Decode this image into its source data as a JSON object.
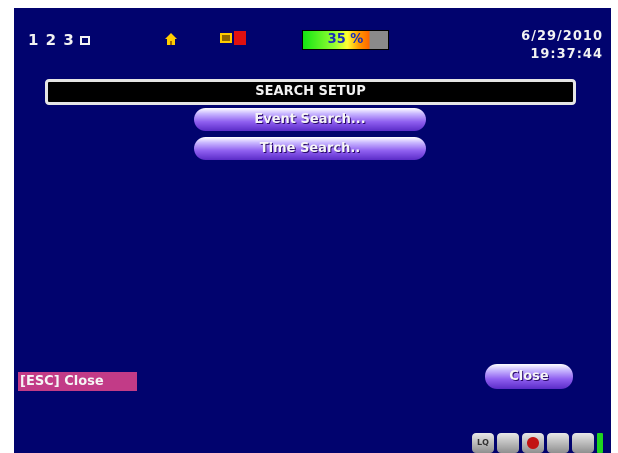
{
  "status": {
    "channels": "1 2 3",
    "hdd_usage": "35 %",
    "date": "6/29/2010",
    "time": "19:37:44"
  },
  "dialog": {
    "title": "SEARCH SETUP",
    "menu": [
      {
        "label": "Event Search..."
      },
      {
        "label": "Time Search.."
      }
    ]
  },
  "footer": {
    "esc_hint": "[ESC] Close",
    "close_label": "Close"
  },
  "taskbar": {
    "icons": [
      "lq-icon",
      "video-icon",
      "record-icon",
      "playback-icon",
      "settings-icon"
    ]
  },
  "colors": {
    "background": "#01036e",
    "title_bar": "#000000",
    "button_purple": "#7a4be6",
    "esc_highlight": "#c23b87"
  }
}
